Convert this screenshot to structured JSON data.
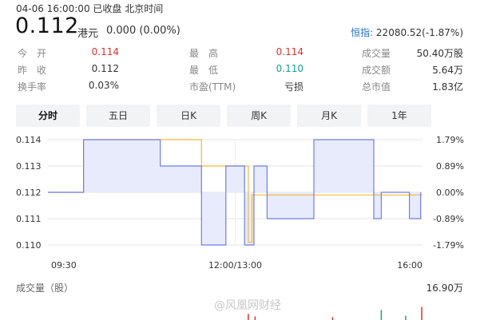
{
  "header": {
    "status_line": "04-06 16:00:00   已收盘   北京时间",
    "price": "0.112",
    "currency": "港元",
    "change": "0.000 (0.00%)",
    "index_name": "恒指:",
    "index_value": " 22080.52(-1.87%)"
  },
  "stats": [
    [
      {
        "label": "今　开",
        "value": "0.114",
        "color": "red"
      },
      {
        "label": "最　高",
        "value": "0.114",
        "color": "red"
      },
      {
        "label": "成交量",
        "value": "50.40万股"
      }
    ],
    [
      {
        "label": "昨　收",
        "value": "0.112"
      },
      {
        "label": "最　低",
        "value": "0.110",
        "color": "green"
      },
      {
        "label": "成交额",
        "value": "5.64万"
      }
    ],
    [
      {
        "label": "换手率",
        "value": "0.03%"
      },
      {
        "label": "市盈(TTM)",
        "value": "亏损"
      },
      {
        "label": "总市值",
        "value": "1.83亿"
      }
    ]
  ],
  "tabs": [
    "分时",
    "五日",
    "日K",
    "周K",
    "月K",
    "1年"
  ],
  "active_tab": "分时",
  "colors": {
    "price_line": "#6f7ee8",
    "price_fill": "#e4e7fb",
    "avg_line": "#f0b93a",
    "vol_red": "#e0312c",
    "vol_teal": "#16a38a",
    "up": "#e0312c",
    "down": "#16a38a"
  },
  "chart_data": {
    "type": "line",
    "title": "",
    "y_labels_left": [
      "0.114",
      "0.113",
      "0.112",
      "0.111",
      "0.110"
    ],
    "y_labels_right": [
      "1.79%",
      "0.89%",
      "0.00%",
      "-0.89%",
      "-1.79%"
    ],
    "x_labels": [
      "09:30",
      "12:00/13:00",
      "16:00"
    ],
    "ylim": [
      0.11,
      0.114
    ],
    "prev_close": 0.112,
    "price_series": {
      "name": "",
      "points": [
        [
          0.0,
          0.112
        ],
        [
          0.095,
          0.112
        ],
        [
          0.095,
          0.114
        ],
        [
          0.3,
          0.114
        ],
        [
          0.3,
          0.113
        ],
        [
          0.41,
          0.113
        ],
        [
          0.41,
          0.11
        ],
        [
          0.475,
          0.11
        ],
        [
          0.475,
          0.113
        ],
        [
          0.525,
          0.113
        ],
        [
          0.525,
          0.11
        ],
        [
          0.55,
          0.11
        ],
        [
          0.55,
          0.113
        ],
        [
          0.585,
          0.113
        ],
        [
          0.585,
          0.111
        ],
        [
          0.71,
          0.111
        ],
        [
          0.71,
          0.114
        ],
        [
          0.87,
          0.114
        ],
        [
          0.87,
          0.111
        ],
        [
          0.89,
          0.111
        ],
        [
          0.89,
          0.112
        ],
        [
          0.965,
          0.112
        ],
        [
          0.965,
          0.111
        ],
        [
          0.995,
          0.111
        ],
        [
          0.995,
          0.112
        ]
      ]
    },
    "avg_series": {
      "name": "",
      "points": [
        [
          0.0,
          0.112
        ],
        [
          0.095,
          0.112
        ],
        [
          0.095,
          0.114
        ],
        [
          0.41,
          0.114
        ],
        [
          0.41,
          0.113
        ],
        [
          0.535,
          0.113
        ],
        [
          0.535,
          0.1101
        ],
        [
          0.545,
          0.1101
        ],
        [
          0.545,
          0.1119
        ],
        [
          1.0,
          0.1119
        ]
      ]
    },
    "volume": {
      "label": "成交量（股）",
      "max_label": "16.90万",
      "bars": [
        [
          0.535,
          0.25,
          "red"
        ],
        [
          0.553,
          0.15,
          "red"
        ],
        [
          0.76,
          0.12,
          "red"
        ],
        [
          0.89,
          0.42,
          "teal"
        ],
        [
          0.955,
          0.18,
          "teal"
        ],
        [
          0.998,
          0.55,
          "red"
        ]
      ]
    }
  },
  "watermark": "@风凰网财经"
}
